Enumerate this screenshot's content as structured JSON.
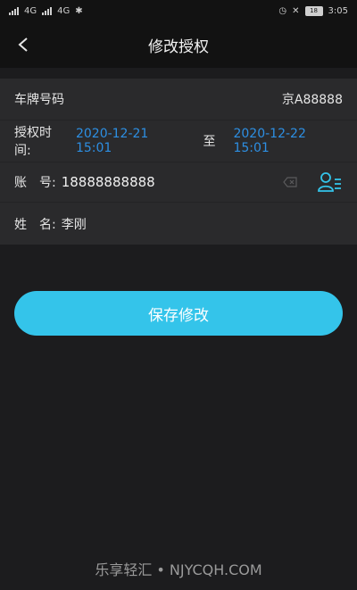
{
  "statusbar": {
    "time": "3:05",
    "battery": "18",
    "net1": "4G",
    "net2": "4G"
  },
  "navbar": {
    "title": "修改授权"
  },
  "form": {
    "plate_label": "车牌号码",
    "plate_value": "京A88888",
    "auth_time_label": "授权时间:",
    "start_time": "2020-12-21 15:01",
    "to_label": "至",
    "end_time": "2020-12-22 15:01",
    "account_label": "账　号:",
    "account_value": "18888888888",
    "name_label": "姓　名:",
    "name_value": "李刚"
  },
  "actions": {
    "save_label": "保存修改"
  },
  "watermark": {
    "text": "乐享轻汇 • NJYCQH.COM"
  },
  "colors": {
    "accent": "#34c4ea",
    "link": "#2d8fe3"
  },
  "icons": [
    "back-arrow-icon",
    "clear-icon",
    "contact-list-icon",
    "signal-icon",
    "battery-icon",
    "bluetooth-icon",
    "alarm-icon",
    "mute-icon"
  ]
}
